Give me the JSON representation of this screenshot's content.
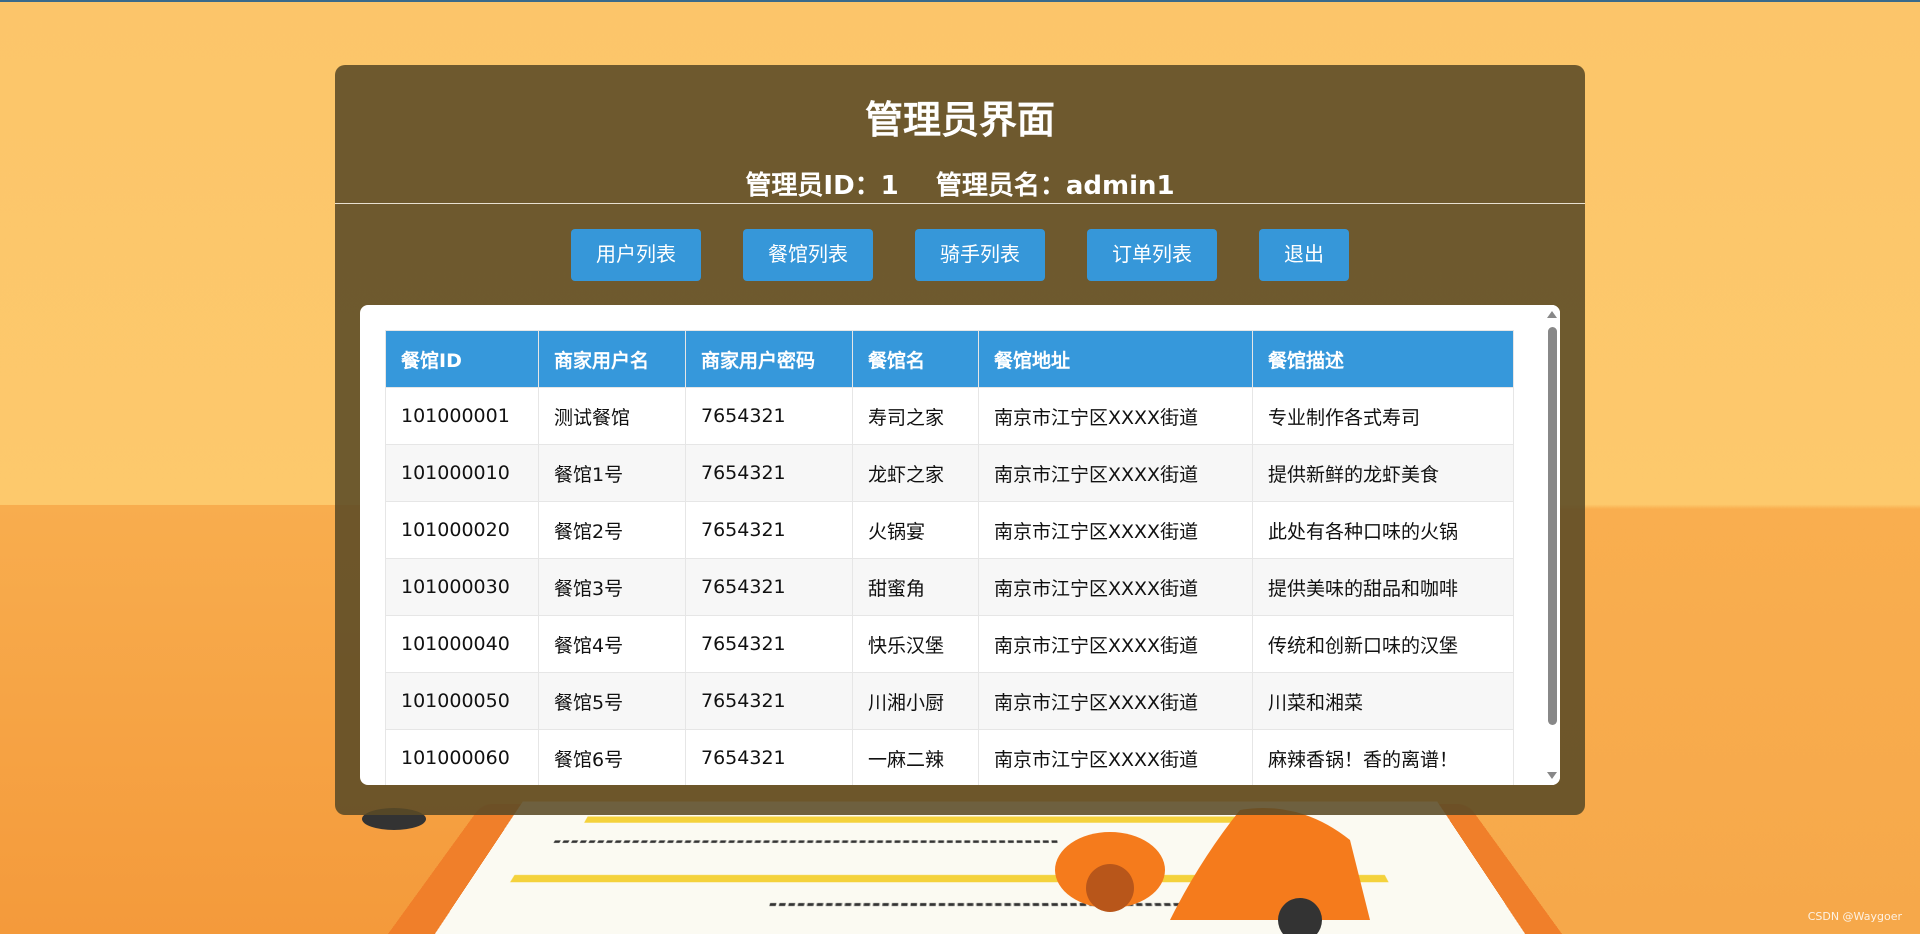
{
  "header": {
    "title": "管理员界面",
    "admin_id": "管理员ID：1",
    "admin_name": "管理员名：admin1"
  },
  "nav": {
    "users": "用户列表",
    "restaurants": "餐馆列表",
    "riders": "骑手列表",
    "orders": "订单列表",
    "logout": "退出"
  },
  "table": {
    "headers": [
      "餐馆ID",
      "商家用户名",
      "商家用户密码",
      "餐馆名",
      "餐馆地址",
      "餐馆描述"
    ],
    "rows": [
      [
        "101000001",
        "测试餐馆",
        "7654321",
        "寿司之家",
        "南京市江宁区XXXX街道",
        "专业制作各式寿司"
      ],
      [
        "101000010",
        "餐馆1号",
        "7654321",
        "龙虾之家",
        "南京市江宁区XXXX街道",
        "提供新鲜的龙虾美食"
      ],
      [
        "101000020",
        "餐馆2号",
        "7654321",
        "火锅宴",
        "南京市江宁区XXXX街道",
        "此处有各种口味的火锅"
      ],
      [
        "101000030",
        "餐馆3号",
        "7654321",
        "甜蜜角",
        "南京市江宁区XXXX街道",
        "提供美味的甜品和咖啡"
      ],
      [
        "101000040",
        "餐馆4号",
        "7654321",
        "快乐汉堡",
        "南京市江宁区XXXX街道",
        "传统和创新口味的汉堡"
      ],
      [
        "101000050",
        "餐馆5号",
        "7654321",
        "川湘小厨",
        "南京市江宁区XXXX街道",
        "川菜和湘菜"
      ],
      [
        "101000060",
        "餐馆6号",
        "7654321",
        "一麻二辣",
        "南京市江宁区XXXX街道",
        "麻辣香锅！香的离谱！"
      ]
    ]
  },
  "watermark": "CSDN @Waygoer",
  "colors": {
    "accent": "#3698db",
    "panel": "#5a4a26",
    "background": "#fcc56a"
  }
}
